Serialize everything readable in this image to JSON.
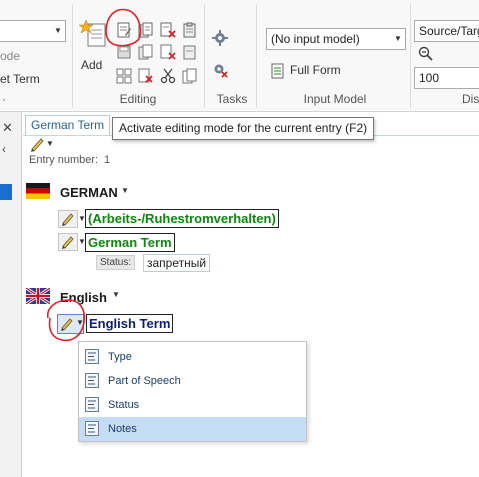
{
  "ribbon": {
    "left_partial_top": "ode",
    "left_partial_bottom": "et Term",
    "add_label": "Add",
    "groups": {
      "editing": "Editing",
      "tasks": "Tasks",
      "input_model": "Input Model",
      "display_partial": "Dis"
    },
    "input_model_combo": "(No input model)",
    "full_form_label": "Full Form",
    "source_target_combo": "Source/Targ",
    "zoom_value": "100"
  },
  "tab": {
    "label": "German Term",
    "tooltip": "Activate editing mode for the current entry (F2)"
  },
  "entry": {
    "number_label": "Entry number:",
    "number_value": "1"
  },
  "german": {
    "language": "GERMAN",
    "term_1": "(Arbeits-/Ruhestromverhalten)",
    "term_2": "German Term",
    "status_label": "Status:",
    "status_value": "запретный"
  },
  "english": {
    "language": "English",
    "term": "English Term"
  },
  "menu": {
    "items": [
      {
        "label": "Type"
      },
      {
        "label": "Part of Speech"
      },
      {
        "label": "Status"
      },
      {
        "label": "Notes"
      }
    ]
  },
  "colors": {
    "term_green": "#0b8a0b",
    "term_navy": "#0b1f7a",
    "menu_selected": "#c4dcf4",
    "annotation_red": "#e8212a"
  }
}
